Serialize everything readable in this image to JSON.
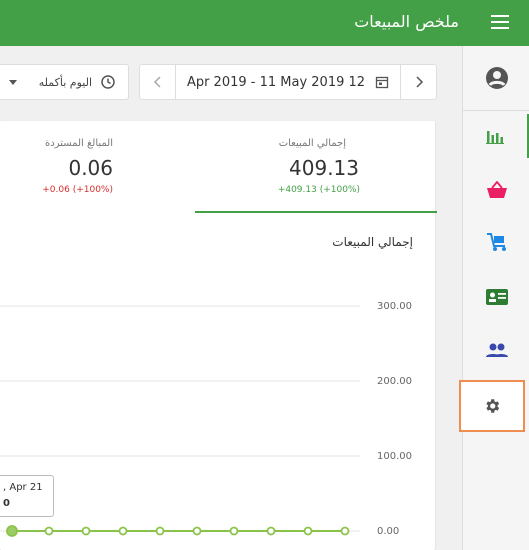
{
  "header": {
    "title": "ملخص المبيعات",
    "menu_icon": "hamburger-icon"
  },
  "toolbar": {
    "period_label": "اليوم بأكمله",
    "date_range": "Apr 2019 - 11 May 2019 12",
    "prev_icon": "chevron-left-icon",
    "next_icon": "chevron-right-icon"
  },
  "stats": [
    {
      "label": "إجمالي المبيعات",
      "value": "409.13",
      "change": "+409.13 (+100%)",
      "change_color": "#43a047"
    },
    {
      "label": "المبالغ المستردة",
      "value": "0.06",
      "change": "+0.06 (+100%)",
      "change_color": "#d32f2f"
    }
  ],
  "chart": {
    "title": "إجمالي المبيعات",
    "y_ticks": [
      "300.00",
      "200.00",
      "100.00",
      "0.00"
    ],
    "tooltip_line1": "21 Apr ,",
    "tooltip_line2": "0"
  },
  "chart_data": {
    "type": "line",
    "yticks": [
      0,
      100,
      200,
      300
    ],
    "series": [
      {
        "values": [
          0,
          0,
          0,
          0,
          0,
          0,
          0,
          0,
          0,
          0
        ]
      }
    ],
    "point_color": "#8bc34a"
  },
  "sidebar": {
    "items": [
      {
        "icon": "account-circle-icon",
        "label": "account"
      },
      {
        "icon": "bar-chart-icon",
        "label": "sales"
      },
      {
        "icon": "basket-icon",
        "label": "orders"
      },
      {
        "icon": "cart-icon",
        "label": "products"
      },
      {
        "icon": "id-card-icon",
        "label": "customers"
      },
      {
        "icon": "people-icon",
        "label": "staff"
      },
      {
        "icon": "gear-icon",
        "label": "settings"
      }
    ]
  }
}
